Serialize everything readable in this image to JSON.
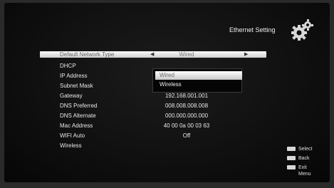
{
  "header": {
    "title": "Ethernet Setting",
    "icon": "gear-icon"
  },
  "menu": {
    "selected": {
      "label": "Default Network Type",
      "value": "Wired"
    },
    "rows": [
      {
        "label": "DHCP",
        "value": ""
      },
      {
        "label": "IP Address",
        "value": ""
      },
      {
        "label": "Subnet Mask",
        "value": ""
      },
      {
        "label": "Gateway",
        "value": "192.168.001.001"
      },
      {
        "label": "DNS Preferred",
        "value": "008.008.008.008"
      },
      {
        "label": "DNS Alternate",
        "value": "000.000.000.000"
      },
      {
        "label": "Mac Address",
        "value": "40 00 0a 00 03 63"
      },
      {
        "label": "WIFI Auto",
        "value": "Off"
      },
      {
        "label": "Wireless",
        "value": ""
      }
    ]
  },
  "dropdown": {
    "options": [
      "Wired",
      "Wireless"
    ],
    "highlighted": "Wired"
  },
  "legend": {
    "select": "Select",
    "back": "Back",
    "exit": "Exit Menu"
  }
}
